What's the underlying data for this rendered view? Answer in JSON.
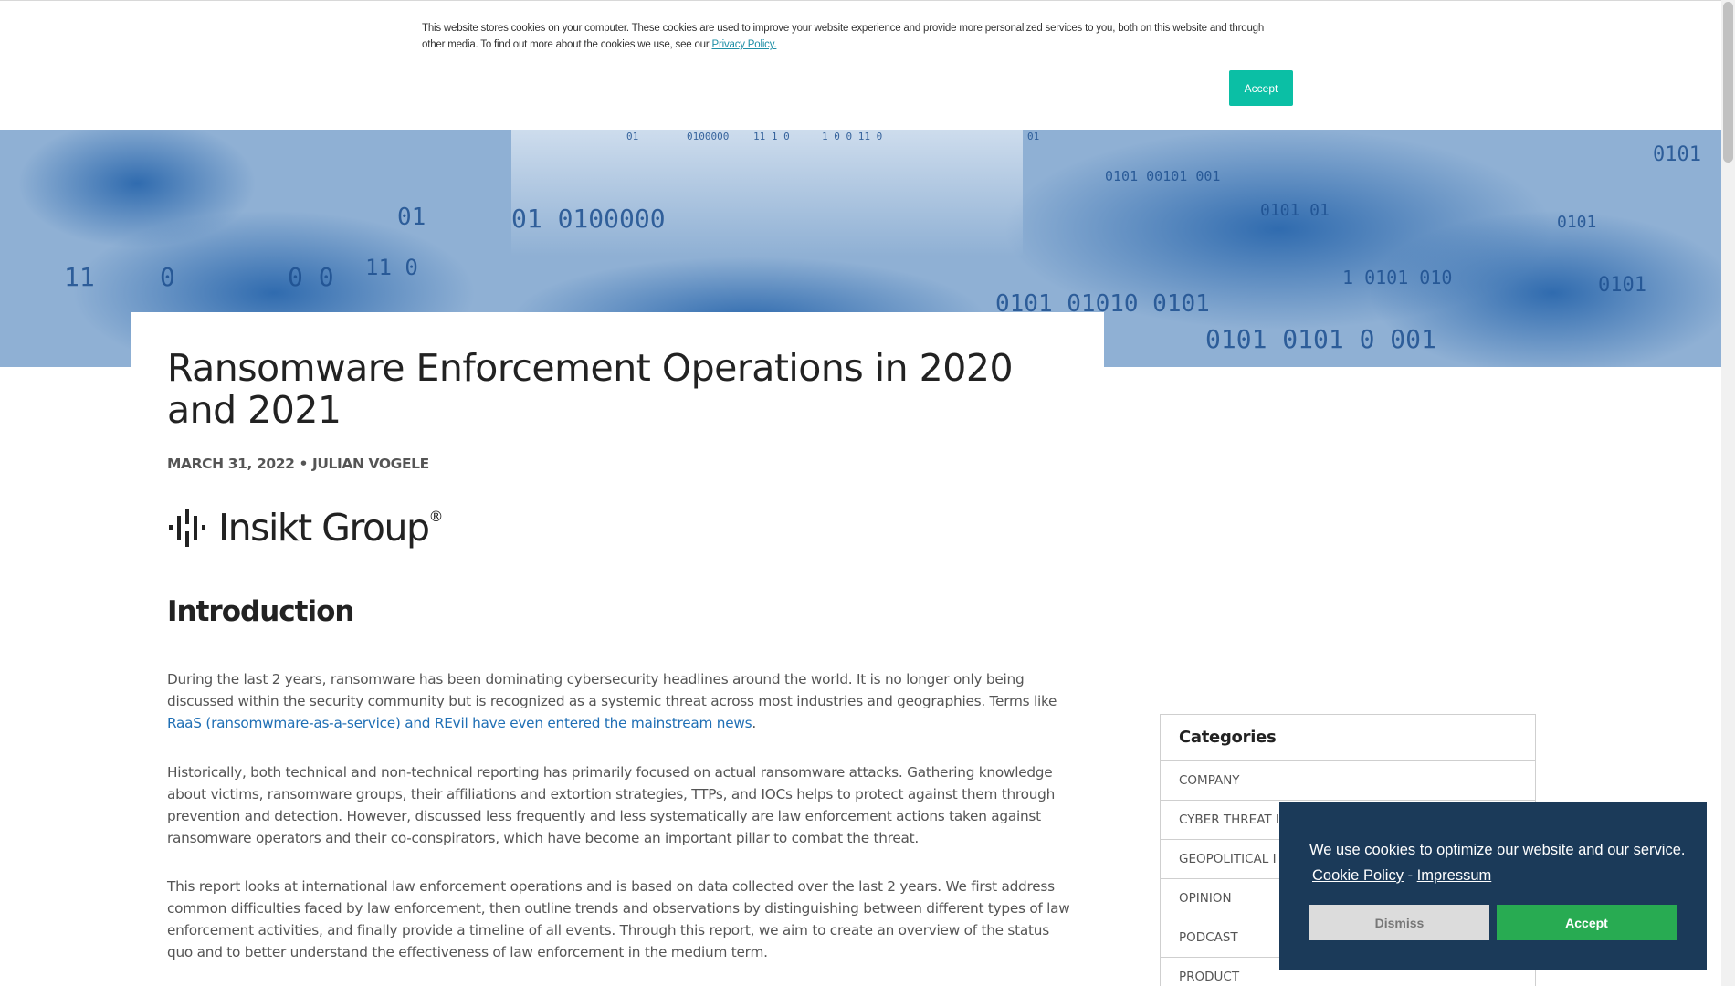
{
  "cookie_notice": {
    "text": "This website stores cookies on your computer. These cookies are used to improve your website experience and provide more personalized services to you, both on this website and through other media. To find out more about the cookies we use, see our",
    "privacy_link": "Privacy Policy.",
    "accept_label": "Accept",
    "accent_color": "#0bbfa5"
  },
  "hero": {
    "binary_strings": [
      "01",
      "0100000",
      "11  1  0",
      "1  0 0  11 0",
      "01",
      "0101",
      "11",
      "0",
      "0 0",
      "11 0",
      "01",
      "01 0100000",
      "0101 00101 001",
      "0101",
      "0101 01010 0101",
      "1 0101 010",
      "0101 01",
      "0101",
      "0101 0101 0 001"
    ]
  },
  "article": {
    "title": "Ransomware Enforcement Operations in 2020 and 2021",
    "meta": "MARCH 31, 2022 • JULIAN VOGELE",
    "logo_text": "Insikt Group",
    "logo_reg": "®",
    "section_heading": "Introduction",
    "paragraph1_text": "During the last 2 years, ransomware has been dominating cybersecurity headlines around the world. It is no longer only being discussed within the security community but is recognized as a systemic threat across most industries and geographies. Terms like ",
    "paragraph1_link": "RaaS (ransomwmare-as-a-service) and REvil have even entered the mainstream news",
    "paragraph1_end": ".",
    "paragraph2": "Historically, both technical and non-technical reporting has primarily focused on actual ransomware attacks. Gathering knowledge about victims, ransomware groups, their affiliations and extortion strategies, TTPs, and IOCs helps to protect against them through prevention and detection. However, discussed less frequently and less systematically are law enforcement actions taken against ransomware operators and their co-conspirators, which have become an important pillar to combat the threat.",
    "paragraph3": "This report looks at international law enforcement operations and is based on data collected over the last 2 years. We first address common difficulties faced by law enforcement, then outline trends and observations by distinguishing between different types of law enforcement activities, and finally provide a timeline of all events. Through this report, we aim to create an overview of the status quo and to better understand the effectiveness of law enforcement in the medium term."
  },
  "sidebar": {
    "categories_title": "Categories",
    "items": [
      "COMPANY",
      "CYBER THREAT I",
      "GEOPOLITICAL I",
      "OPINION",
      "PODCAST",
      "PRODUCT"
    ]
  },
  "cookie_popup": {
    "message": "We use cookies to optimize our website and our service.",
    "cookie_policy_link": "Cookie Policy",
    "separator": "-",
    "impressum_link": "Impressum",
    "dismiss_label": "Dismiss",
    "accept_label": "Accept",
    "background_color": "#1b3a59",
    "accept_color": "#28ab52"
  }
}
